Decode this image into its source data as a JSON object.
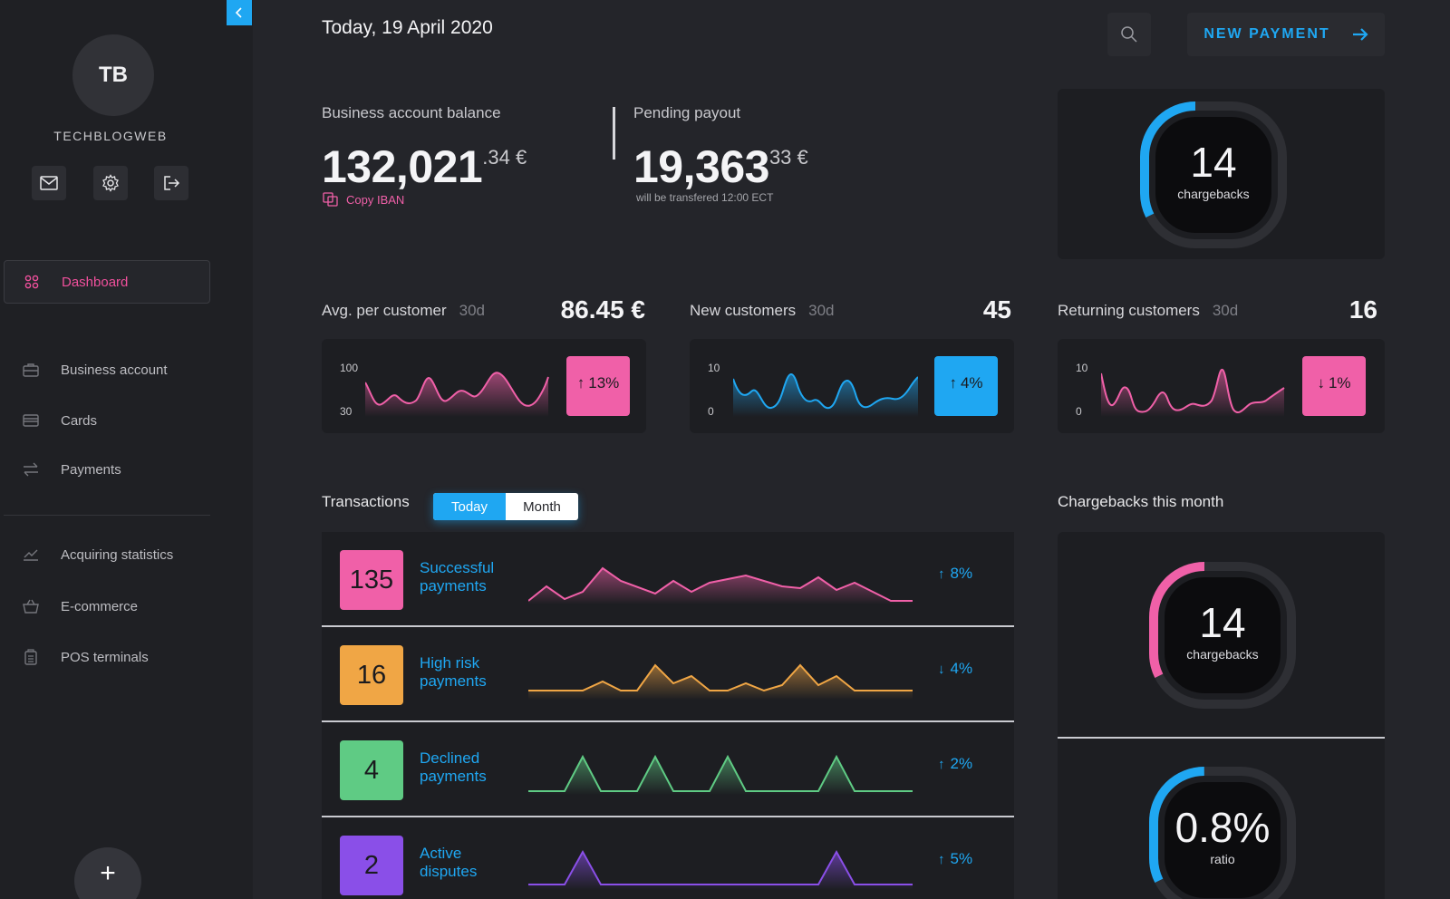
{
  "user": {
    "initials": "TB",
    "name": "TECHBLOGWEB"
  },
  "header": {
    "date": "Today, 19 April 2020",
    "new_payment_label": "NEW PAYMENT"
  },
  "nav": {
    "primary": [
      {
        "label": "Dashboard",
        "icon": "grid-icon",
        "active": true
      }
    ],
    "accounts": [
      {
        "label": "Business account",
        "icon": "briefcase-icon"
      },
      {
        "label": "Cards",
        "icon": "card-icon"
      },
      {
        "label": "Payments",
        "icon": "transfer-icon"
      }
    ],
    "stats": [
      {
        "label": "Acquiring statistics",
        "icon": "chart-icon"
      },
      {
        "label": "E-commerce",
        "icon": "basket-icon"
      },
      {
        "label": "POS terminals",
        "icon": "pos-icon"
      }
    ]
  },
  "balance": {
    "label": "Business account balance",
    "integer": "132,021",
    "decimal": ".34 €",
    "copy_label": "Copy IBAN"
  },
  "payout": {
    "label": "Pending payout",
    "integer": "19,363",
    "decimal": "33 €",
    "note": "will be transfered 12:00  ECT"
  },
  "chargebacks_gauge": {
    "value": "14",
    "label": "chargebacks",
    "fraction": 0.45
  },
  "metrics": [
    {
      "title": "Avg. per customer",
      "period": "30d",
      "value": "86.45 €",
      "axis_top": "100",
      "axis_bottom": "30",
      "change": "13%",
      "direction": "up",
      "color": "#f060a8"
    },
    {
      "title": "New customers",
      "period": "30d",
      "value": "45",
      "axis_top": "10",
      "axis_bottom": "0",
      "change": "4%",
      "direction": "up",
      "color": "#1fa7f2"
    },
    {
      "title": "Returning customers",
      "period": "30d",
      "value": "16",
      "axis_top": "10",
      "axis_bottom": "0",
      "change": "1%",
      "direction": "down",
      "color": "#f060a8"
    }
  ],
  "transactions": {
    "title": "Transactions",
    "tabs": [
      "Today",
      "Month"
    ],
    "active_tab": "Today",
    "rows": [
      {
        "count": "135",
        "label_line1": "Successful",
        "label_line2": "payments",
        "change": "8%",
        "direction": "up",
        "color": "#f060a8"
      },
      {
        "count": "16",
        "label_line1": "High risk",
        "label_line2": "payments",
        "change": "4%",
        "direction": "down",
        "color": "#f0a645"
      },
      {
        "count": "4",
        "label_line1": "Declined",
        "label_line2": "payments",
        "change": "2%",
        "direction": "up",
        "color": "#5fcb84"
      },
      {
        "count": "2",
        "label_line1": "Active",
        "label_line2": "disputes",
        "change": "5%",
        "direction": "up",
        "color": "#8a4fe8"
      }
    ]
  },
  "chargebacks_month": {
    "title": "Chargebacks this month",
    "gauge1": {
      "value": "14",
      "label": "chargebacks",
      "fraction": 0.4,
      "color": "#f060a8"
    },
    "gauge2": {
      "value": "0.8%",
      "label": "ratio",
      "fraction": 0.3,
      "color": "#1fa7f2"
    }
  }
}
